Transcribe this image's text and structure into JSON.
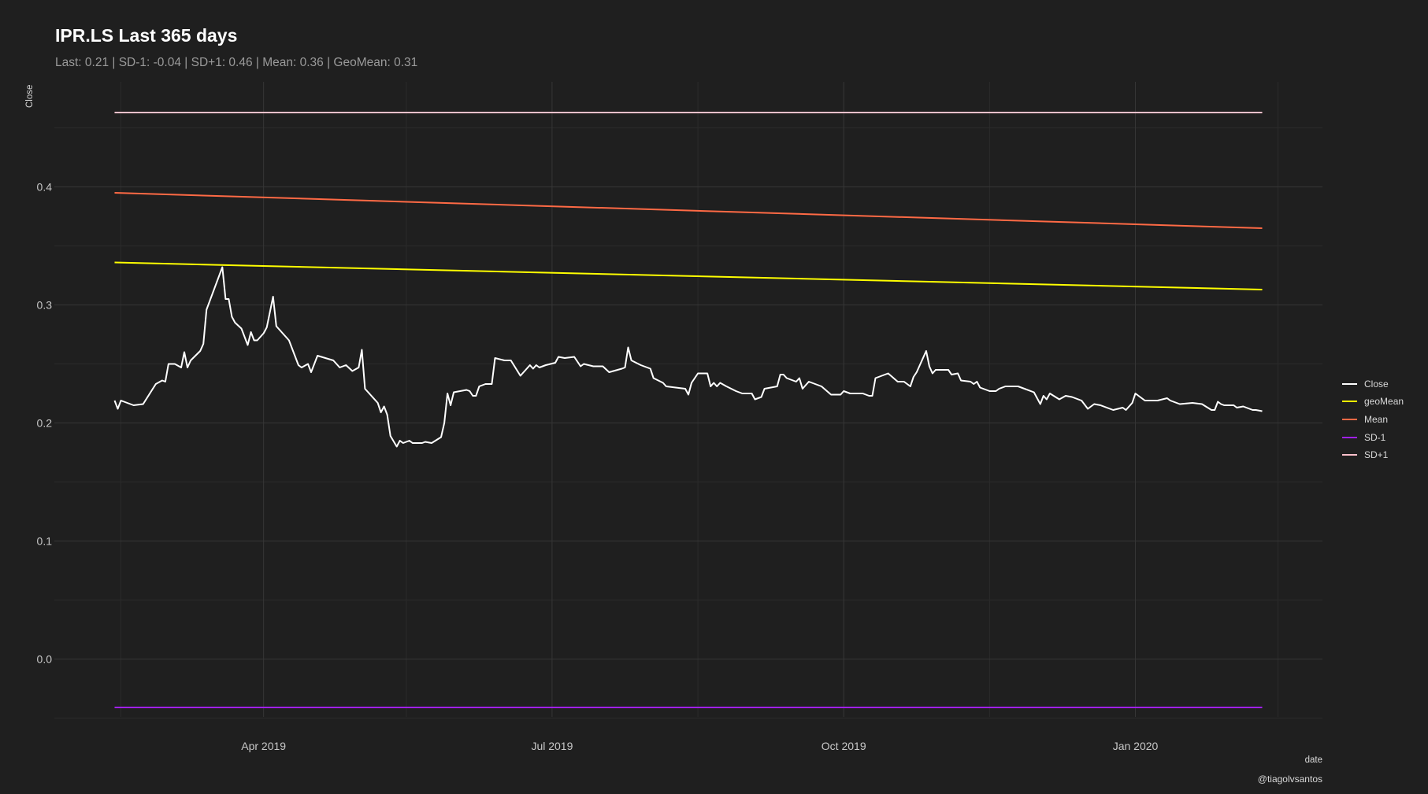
{
  "chart_data": {
    "type": "line",
    "title": "IPR.LS Last 365 days",
    "subtitle": "Last: 0.21 | SD-1: -0.04 | SD+1: 0.46 | Mean: 0.36 | GeoMean: 0.31",
    "xlabel": "date",
    "ylabel": "Close",
    "caption": "@tiagolvsantos",
    "x_unit": "days since 2019-02-13",
    "xlim": [
      -19,
      381
    ],
    "ylim": [
      -0.049,
      0.489
    ],
    "grid": true,
    "legend_position": "right",
    "x_ticks": [
      {
        "day": 47,
        "label": "Apr 2019"
      },
      {
        "day": 138,
        "label": "Jul 2019"
      },
      {
        "day": 230,
        "label": "Oct 2019"
      },
      {
        "day": 322,
        "label": "Jan 2020"
      }
    ],
    "x_minor_ticks": [
      2,
      92,
      184,
      276,
      367
    ],
    "y_ticks": [
      {
        "value": 0.0,
        "label": "0.0"
      },
      {
        "value": 0.1,
        "label": "0.1"
      },
      {
        "value": 0.2,
        "label": "0.2"
      },
      {
        "value": 0.3,
        "label": "0.3"
      },
      {
        "value": 0.4,
        "label": "0.4"
      }
    ],
    "y_minor_ticks": [
      -0.05,
      0.05,
      0.15,
      0.25,
      0.35,
      0.45
    ],
    "series": [
      {
        "name": "Close",
        "color": "#ffffff",
        "points": [
          [
            0,
            0.219
          ],
          [
            1,
            0.212
          ],
          [
            2,
            0.219
          ],
          [
            6,
            0.215
          ],
          [
            9,
            0.216
          ],
          [
            13,
            0.233
          ],
          [
            15,
            0.236
          ],
          [
            16,
            0.235
          ],
          [
            17,
            0.25
          ],
          [
            19,
            0.25
          ],
          [
            21,
            0.247
          ],
          [
            22,
            0.26
          ],
          [
            23,
            0.247
          ],
          [
            24,
            0.253
          ],
          [
            27,
            0.261
          ],
          [
            28,
            0.267
          ],
          [
            29,
            0.296
          ],
          [
            34,
            0.332
          ],
          [
            35,
            0.305
          ],
          [
            36,
            0.305
          ],
          [
            37,
            0.29
          ],
          [
            38,
            0.285
          ],
          [
            40,
            0.28
          ],
          [
            42,
            0.266
          ],
          [
            43,
            0.277
          ],
          [
            44,
            0.27
          ],
          [
            45,
            0.27
          ],
          [
            47,
            0.276
          ],
          [
            48,
            0.281
          ],
          [
            50,
            0.307
          ],
          [
            51,
            0.282
          ],
          [
            55,
            0.27
          ],
          [
            58,
            0.249
          ],
          [
            59,
            0.247
          ],
          [
            61,
            0.25
          ],
          [
            62,
            0.243
          ],
          [
            64,
            0.257
          ],
          [
            69,
            0.253
          ],
          [
            71,
            0.247
          ],
          [
            73,
            0.249
          ],
          [
            75,
            0.244
          ],
          [
            77,
            0.247
          ],
          [
            78,
            0.262
          ],
          [
            79,
            0.229
          ],
          [
            83,
            0.217
          ],
          [
            84,
            0.209
          ],
          [
            85,
            0.214
          ],
          [
            86,
            0.207
          ],
          [
            87,
            0.189
          ],
          [
            89,
            0.18
          ],
          [
            90,
            0.185
          ],
          [
            91,
            0.183
          ],
          [
            93,
            0.185
          ],
          [
            94,
            0.183
          ],
          [
            97,
            0.183
          ],
          [
            98,
            0.184
          ],
          [
            100,
            0.183
          ],
          [
            103,
            0.188
          ],
          [
            104,
            0.2
          ],
          [
            105,
            0.225
          ],
          [
            106,
            0.215
          ],
          [
            107,
            0.226
          ],
          [
            111,
            0.228
          ],
          [
            112,
            0.227
          ],
          [
            113,
            0.223
          ],
          [
            114,
            0.223
          ],
          [
            115,
            0.231
          ],
          [
            117,
            0.233
          ],
          [
            119,
            0.233
          ],
          [
            120,
            0.255
          ],
          [
            123,
            0.253
          ],
          [
            125,
            0.253
          ],
          [
            128,
            0.24
          ],
          [
            131,
            0.249
          ],
          [
            132,
            0.246
          ],
          [
            133,
            0.249
          ],
          [
            134,
            0.247
          ],
          [
            136,
            0.249
          ],
          [
            139,
            0.251
          ],
          [
            140,
            0.256
          ],
          [
            142,
            0.255
          ],
          [
            145,
            0.256
          ],
          [
            147,
            0.248
          ],
          [
            148,
            0.25
          ],
          [
            151,
            0.248
          ],
          [
            154,
            0.248
          ],
          [
            156,
            0.243
          ],
          [
            160,
            0.246
          ],
          [
            161,
            0.247
          ],
          [
            162,
            0.264
          ],
          [
            163,
            0.253
          ],
          [
            166,
            0.249
          ],
          [
            169,
            0.246
          ],
          [
            170,
            0.238
          ],
          [
            173,
            0.234
          ],
          [
            174,
            0.231
          ],
          [
            177,
            0.23
          ],
          [
            180,
            0.229
          ],
          [
            181,
            0.224
          ],
          [
            182,
            0.234
          ],
          [
            184,
            0.242
          ],
          [
            187,
            0.242
          ],
          [
            188,
            0.231
          ],
          [
            189,
            0.234
          ],
          [
            190,
            0.231
          ],
          [
            191,
            0.234
          ],
          [
            193,
            0.231
          ],
          [
            196,
            0.227
          ],
          [
            198,
            0.225
          ],
          [
            201,
            0.225
          ],
          [
            202,
            0.22
          ],
          [
            204,
            0.222
          ],
          [
            205,
            0.229
          ],
          [
            209,
            0.231
          ],
          [
            210,
            0.241
          ],
          [
            211,
            0.241
          ],
          [
            212,
            0.238
          ],
          [
            215,
            0.235
          ],
          [
            216,
            0.238
          ],
          [
            217,
            0.229
          ],
          [
            219,
            0.235
          ],
          [
            223,
            0.231
          ],
          [
            226,
            0.224
          ],
          [
            229,
            0.224
          ],
          [
            230,
            0.227
          ],
          [
            232,
            0.225
          ],
          [
            236,
            0.225
          ],
          [
            238,
            0.223
          ],
          [
            239,
            0.223
          ],
          [
            240,
            0.238
          ],
          [
            244,
            0.242
          ],
          [
            247,
            0.235
          ],
          [
            249,
            0.235
          ],
          [
            251,
            0.231
          ],
          [
            252,
            0.239
          ],
          [
            253,
            0.243
          ],
          [
            256,
            0.261
          ],
          [
            257,
            0.248
          ],
          [
            258,
            0.242
          ],
          [
            259,
            0.245
          ],
          [
            261,
            0.245
          ],
          [
            263,
            0.245
          ],
          [
            264,
            0.241
          ],
          [
            266,
            0.242
          ],
          [
            267,
            0.236
          ],
          [
            270,
            0.235
          ],
          [
            271,
            0.233
          ],
          [
            272,
            0.235
          ],
          [
            273,
            0.23
          ],
          [
            276,
            0.227
          ],
          [
            278,
            0.227
          ],
          [
            279,
            0.229
          ],
          [
            281,
            0.231
          ],
          [
            285,
            0.231
          ],
          [
            287,
            0.229
          ],
          [
            290,
            0.226
          ],
          [
            292,
            0.216
          ],
          [
            293,
            0.223
          ],
          [
            294,
            0.22
          ],
          [
            295,
            0.225
          ],
          [
            298,
            0.22
          ],
          [
            300,
            0.223
          ],
          [
            302,
            0.222
          ],
          [
            305,
            0.219
          ],
          [
            307,
            0.212
          ],
          [
            309,
            0.216
          ],
          [
            311,
            0.215
          ],
          [
            315,
            0.211
          ],
          [
            318,
            0.213
          ],
          [
            319,
            0.211
          ],
          [
            321,
            0.217
          ],
          [
            322,
            0.225
          ],
          [
            325,
            0.219
          ],
          [
            327,
            0.219
          ],
          [
            329,
            0.219
          ],
          [
            332,
            0.221
          ],
          [
            333,
            0.219
          ],
          [
            336,
            0.216
          ],
          [
            340,
            0.217
          ],
          [
            343,
            0.216
          ],
          [
            346,
            0.211
          ],
          [
            347,
            0.211
          ],
          [
            348,
            0.218
          ],
          [
            349,
            0.216
          ],
          [
            350,
            0.215
          ],
          [
            353,
            0.215
          ],
          [
            354,
            0.213
          ],
          [
            356,
            0.214
          ],
          [
            359,
            0.211
          ],
          [
            360,
            0.211
          ],
          [
            362,
            0.21
          ]
        ]
      },
      {
        "name": "geoMean",
        "color": "#ffff00",
        "points": [
          [
            0,
            0.336
          ],
          [
            362,
            0.313
          ]
        ]
      },
      {
        "name": "Mean",
        "color": "#ff6a45",
        "points": [
          [
            0,
            0.395
          ],
          [
            362,
            0.365
          ]
        ]
      },
      {
        "name": "SD-1",
        "color": "#a020f0",
        "points": [
          [
            0,
            -0.041
          ],
          [
            362,
            -0.041
          ]
        ]
      },
      {
        "name": "SD+1",
        "color": "#ffc0cb",
        "points": [
          [
            0,
            0.463
          ],
          [
            362,
            0.463
          ]
        ]
      }
    ],
    "legend": [
      "Close",
      "geoMean",
      "Mean",
      "SD-1",
      "SD+1"
    ]
  }
}
